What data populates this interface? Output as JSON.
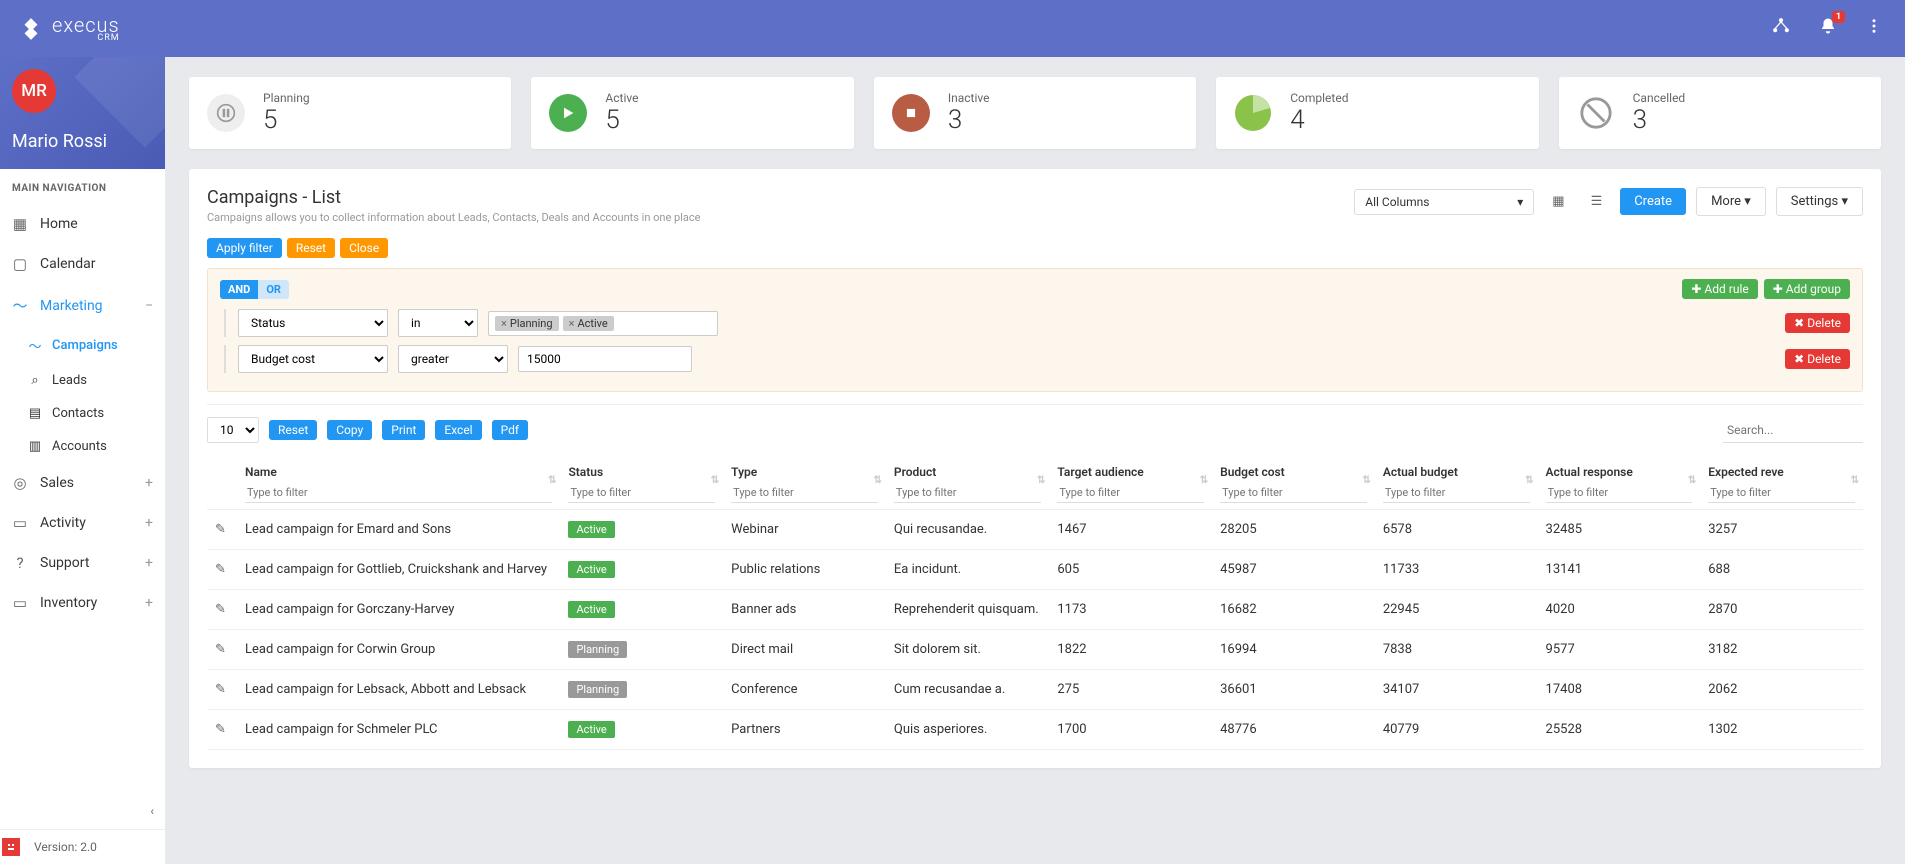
{
  "app": {
    "name": "execus",
    "sub": "CRM",
    "notif_count": "1"
  },
  "user": {
    "initials": "MR",
    "name": "Mario Rossi"
  },
  "nav": {
    "title": "MAIN NAVIGATION",
    "home": "Home",
    "calendar": "Calendar",
    "marketing": "Marketing",
    "campaigns": "Campaigns",
    "leads": "Leads",
    "contacts": "Contacts",
    "accounts": "Accounts",
    "sales": "Sales",
    "activity": "Activity",
    "support": "Support",
    "inventory": "Inventory",
    "version": "Version: 2.0"
  },
  "cards": {
    "planning": {
      "label": "Planning",
      "value": "5"
    },
    "active": {
      "label": "Active",
      "value": "5"
    },
    "inactive": {
      "label": "Inactive",
      "value": "3"
    },
    "completed": {
      "label": "Completed",
      "value": "4"
    },
    "cancelled": {
      "label": "Cancelled",
      "value": "3"
    }
  },
  "page": {
    "title": "Campaigns - List",
    "sub": "Campaigns allows you to collect information about Leads, Contacts, Deals and Accounts in one place",
    "all_columns": "All Columns",
    "create": "Create",
    "more": "More",
    "settings": "Settings"
  },
  "filter": {
    "apply": "Apply filter",
    "reset": "Reset",
    "close": "Close",
    "and": "AND",
    "or": "OR",
    "add_rule": "Add rule",
    "add_group": "Add group",
    "delete": "Delete",
    "row1_field": "Status",
    "row1_op": "in",
    "row1_v1": "Planning",
    "row1_v2": "Active",
    "row2_field": "Budget cost",
    "row2_op": "greater",
    "row2_val": "15000"
  },
  "tctl": {
    "page_size": "10",
    "reset": "Reset",
    "copy": "Copy",
    "print": "Print",
    "excel": "Excel",
    "pdf": "Pdf",
    "search_ph": "Search..."
  },
  "cols": {
    "name": "Name",
    "status": "Status",
    "type": "Type",
    "product": "Product",
    "target": "Target audience",
    "budget": "Budget cost",
    "actual_b": "Actual budget",
    "actual_r": "Actual response",
    "expected_r": "Expected reve",
    "filter_ph": "Type to filter"
  },
  "rows": [
    {
      "name": "Lead campaign for Emard and Sons",
      "status": "Active",
      "type": "Webinar",
      "product": "Qui recusandae.",
      "target": "1467",
      "budget": "28205",
      "actual_b": "6578",
      "actual_r": "32485",
      "expected_r": "3257"
    },
    {
      "name": "Lead campaign for Gottlieb, Cruickshank and Harvey",
      "status": "Active",
      "type": "Public relations",
      "product": "Ea incidunt.",
      "target": "605",
      "budget": "45987",
      "actual_b": "11733",
      "actual_r": "13141",
      "expected_r": "688"
    },
    {
      "name": "Lead campaign for Gorczany-Harvey",
      "status": "Active",
      "type": "Banner ads",
      "product": "Reprehenderit quisquam.",
      "target": "1173",
      "budget": "16682",
      "actual_b": "22945",
      "actual_r": "4020",
      "expected_r": "2870"
    },
    {
      "name": "Lead campaign for Corwin Group",
      "status": "Planning",
      "type": "Direct mail",
      "product": "Sit dolorem sit.",
      "target": "1822",
      "budget": "16994",
      "actual_b": "7838",
      "actual_r": "9577",
      "expected_r": "3182"
    },
    {
      "name": "Lead campaign for Lebsack, Abbott and Lebsack",
      "status": "Planning",
      "type": "Conference",
      "product": "Cum recusandae a.",
      "target": "275",
      "budget": "36601",
      "actual_b": "34107",
      "actual_r": "17408",
      "expected_r": "2062"
    },
    {
      "name": "Lead campaign for Schmeler PLC",
      "status": "Active",
      "type": "Partners",
      "product": "Quis asperiores.",
      "target": "1700",
      "budget": "48776",
      "actual_b": "40779",
      "actual_r": "25528",
      "expected_r": "1302"
    }
  ]
}
